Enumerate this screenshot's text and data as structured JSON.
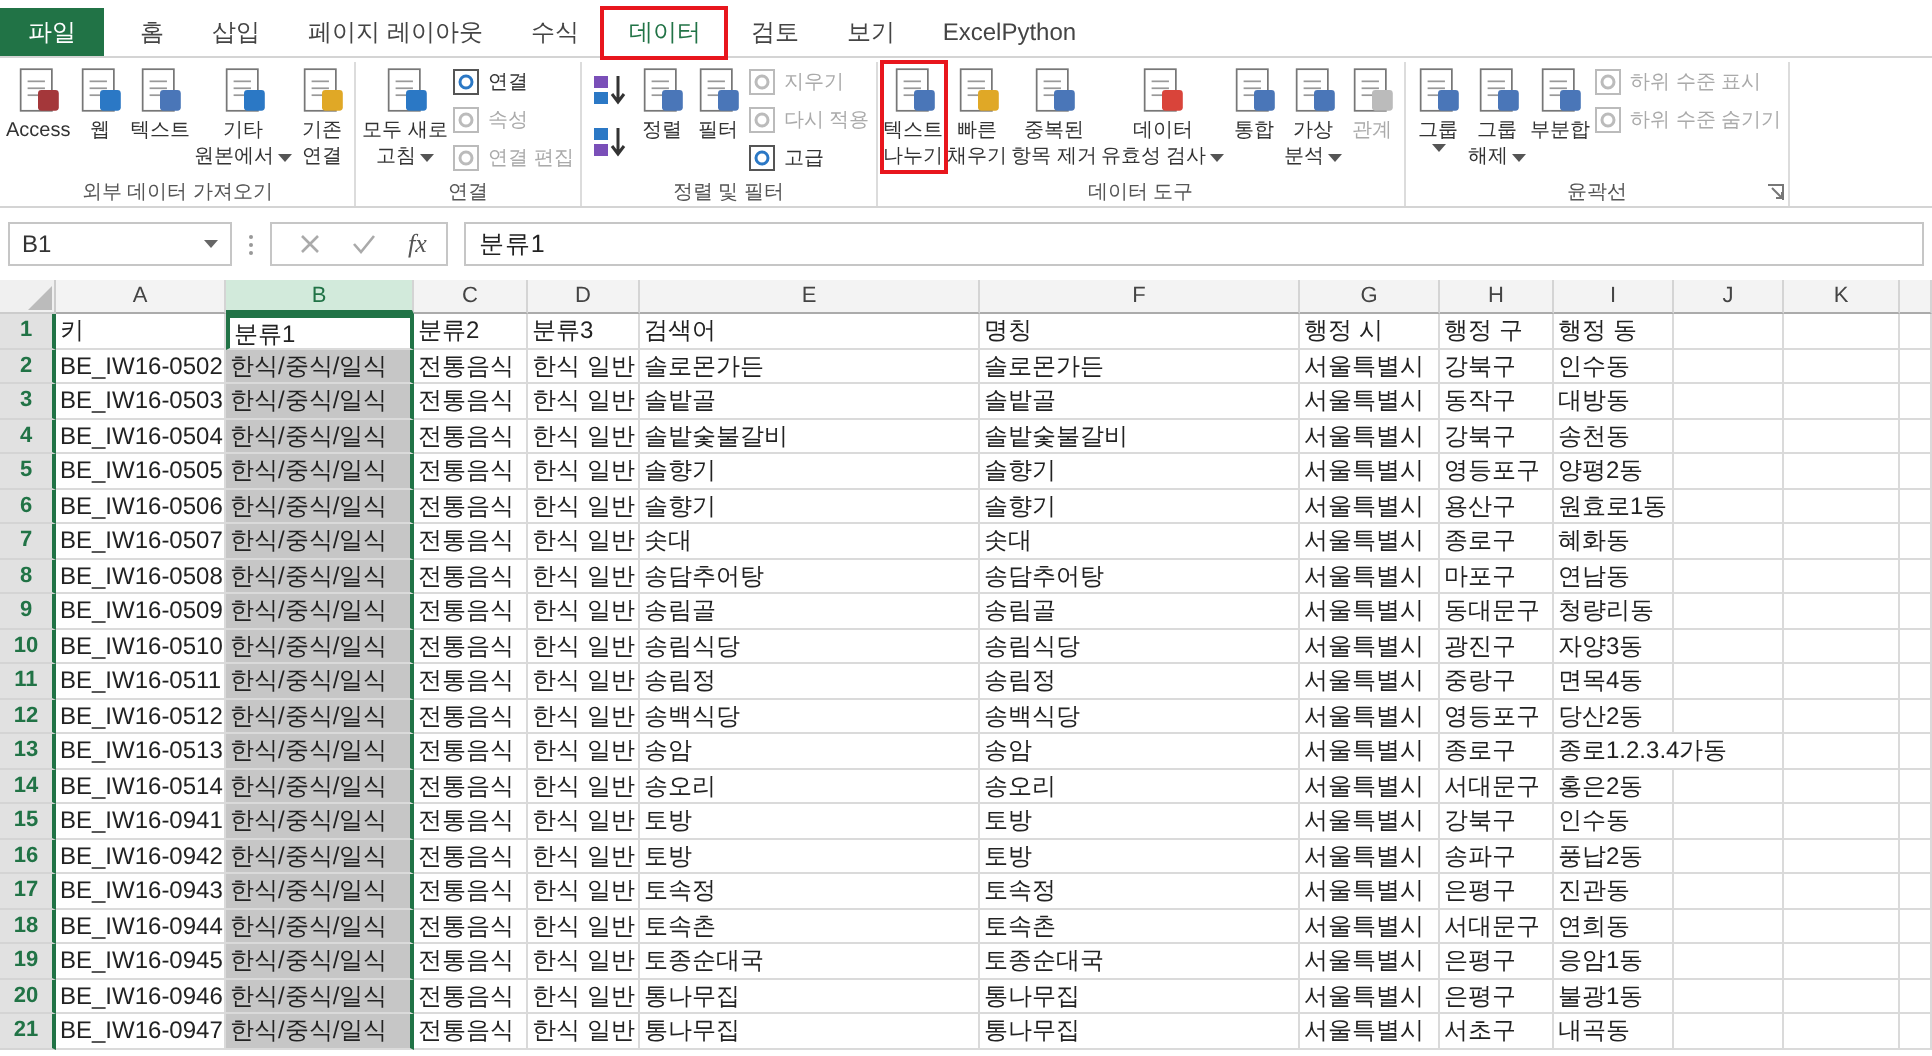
{
  "tabs": [
    {
      "label": "파일",
      "kind": "file",
      "selected": false,
      "highlighted": false
    },
    {
      "label": "홈",
      "kind": "tab",
      "selected": false,
      "highlighted": false
    },
    {
      "label": "삽입",
      "kind": "tab",
      "selected": false,
      "highlighted": false
    },
    {
      "label": "페이지 레이아웃",
      "kind": "tab",
      "selected": false,
      "highlighted": false
    },
    {
      "label": "수식",
      "kind": "tab",
      "selected": false,
      "highlighted": false
    },
    {
      "label": "데이터",
      "kind": "tab",
      "selected": true,
      "highlighted": true
    },
    {
      "label": "검토",
      "kind": "tab",
      "selected": false,
      "highlighted": false
    },
    {
      "label": "보기",
      "kind": "tab",
      "selected": false,
      "highlighted": false
    },
    {
      "label": "ExcelPython",
      "kind": "tab",
      "selected": false,
      "highlighted": false
    }
  ],
  "ribbon": {
    "groups": [
      {
        "label": "외부 데이터 가져오기",
        "items": [
          {
            "kind": "large",
            "lines": [
              "Access"
            ],
            "dropdown": false,
            "disabled": false,
            "highlighted": false
          },
          {
            "kind": "large",
            "lines": [
              "웹"
            ],
            "dropdown": false,
            "disabled": false,
            "highlighted": false
          },
          {
            "kind": "large",
            "lines": [
              "텍스트"
            ],
            "dropdown": false,
            "disabled": false,
            "highlighted": false
          },
          {
            "kind": "large",
            "lines": [
              "기타",
              "원본에서"
            ],
            "dropdown": true,
            "disabled": false,
            "highlighted": false
          },
          {
            "kind": "large",
            "lines": [
              "기존",
              "연결"
            ],
            "dropdown": false,
            "disabled": false,
            "highlighted": false
          }
        ]
      },
      {
        "label": "연결",
        "items": [
          {
            "kind": "large",
            "lines": [
              "모두 새로",
              "고침"
            ],
            "dropdown": true,
            "disabled": false,
            "highlighted": false
          },
          {
            "kind": "stack",
            "items": [
              {
                "label": "연결",
                "disabled": false
              },
              {
                "label": "속성",
                "disabled": true
              },
              {
                "label": "연결 편집",
                "disabled": true
              }
            ]
          }
        ]
      },
      {
        "label": "정렬 및 필터",
        "items": [
          {
            "kind": "sort-icons"
          },
          {
            "kind": "large",
            "lines": [
              "정렬"
            ],
            "dropdown": false,
            "disabled": false,
            "highlighted": false
          },
          {
            "kind": "large",
            "lines": [
              "필터"
            ],
            "dropdown": false,
            "disabled": false,
            "highlighted": false
          },
          {
            "kind": "stack",
            "items": [
              {
                "label": "지우기",
                "disabled": true
              },
              {
                "label": "다시 적용",
                "disabled": true
              },
              {
                "label": "고급",
                "disabled": false
              }
            ]
          }
        ]
      },
      {
        "label": "데이터 도구",
        "items": [
          {
            "kind": "large",
            "lines": [
              "텍스트",
              "나누기"
            ],
            "dropdown": false,
            "disabled": false,
            "highlighted": true
          },
          {
            "kind": "large",
            "lines": [
              "빠른",
              "채우기"
            ],
            "dropdown": false,
            "disabled": false,
            "highlighted": false
          },
          {
            "kind": "large",
            "lines": [
              "중복된",
              "항목 제거"
            ],
            "dropdown": false,
            "disabled": false,
            "highlighted": false
          },
          {
            "kind": "large",
            "lines": [
              "데이터",
              "유효성 검사"
            ],
            "dropdown": true,
            "disabled": false,
            "highlighted": false
          },
          {
            "kind": "large",
            "lines": [
              "통합"
            ],
            "dropdown": false,
            "disabled": false,
            "highlighted": false
          },
          {
            "kind": "large",
            "lines": [
              "가상",
              "분석"
            ],
            "dropdown": true,
            "disabled": false,
            "highlighted": false
          },
          {
            "kind": "large",
            "lines": [
              "관계"
            ],
            "dropdown": false,
            "disabled": true,
            "highlighted": false
          }
        ]
      },
      {
        "label": "윤곽선",
        "items": [
          {
            "kind": "large",
            "lines": [
              "그룹"
            ],
            "dropdown": true,
            "disabled": false,
            "highlighted": false
          },
          {
            "kind": "large",
            "lines": [
              "그룹",
              "해제"
            ],
            "dropdown": true,
            "disabled": false,
            "highlighted": false
          },
          {
            "kind": "large",
            "lines": [
              "부분합"
            ],
            "dropdown": false,
            "disabled": false,
            "highlighted": false
          },
          {
            "kind": "stack",
            "items": [
              {
                "label": "하위 수준 표시",
                "disabled": true
              },
              {
                "label": "하위 수준 숨기기",
                "disabled": true
              }
            ]
          }
        ]
      }
    ]
  },
  "formula_bar": {
    "name_box": "B1",
    "function_label": "fx",
    "value": "분류1"
  },
  "table": {
    "columns": [
      {
        "letter": "A",
        "selected": false
      },
      {
        "letter": "B",
        "selected": true
      },
      {
        "letter": "C",
        "selected": false
      },
      {
        "letter": "D",
        "selected": false
      },
      {
        "letter": "E",
        "selected": false
      },
      {
        "letter": "F",
        "selected": false
      },
      {
        "letter": "G",
        "selected": false
      },
      {
        "letter": "H",
        "selected": false
      },
      {
        "letter": "I",
        "selected": false
      },
      {
        "letter": "J",
        "selected": false
      },
      {
        "letter": "K",
        "selected": false
      }
    ],
    "rows": [
      {
        "number": "1",
        "active": true,
        "cells": [
          "키",
          "분류1",
          "분류2",
          "분류3",
          "검색어",
          "명칭",
          "행정 시",
          "행정 구",
          "행정 동"
        ]
      },
      {
        "number": "2",
        "active": false,
        "cells": [
          "BE_IW16-0502",
          "한식/중식/일식",
          "전통음식",
          "한식 일반",
          "솔로몬가든",
          "솔로몬가든",
          "서울특별시",
          "강북구",
          "인수동"
        ]
      },
      {
        "number": "3",
        "active": false,
        "cells": [
          "BE_IW16-0503",
          "한식/중식/일식",
          "전통음식",
          "한식 일반",
          "솔밭골",
          "솔밭골",
          "서울특별시",
          "동작구",
          "대방동"
        ]
      },
      {
        "number": "4",
        "active": false,
        "cells": [
          "BE_IW16-0504",
          "한식/중식/일식",
          "전통음식",
          "한식 일반",
          "솔밭숯불갈비",
          "솔밭숯불갈비",
          "서울특별시",
          "강북구",
          "송천동"
        ]
      },
      {
        "number": "5",
        "active": false,
        "cells": [
          "BE_IW16-0505",
          "한식/중식/일식",
          "전통음식",
          "한식 일반",
          "솔향기",
          "솔향기",
          "서울특별시",
          "영등포구",
          "양평2동"
        ]
      },
      {
        "number": "6",
        "active": false,
        "cells": [
          "BE_IW16-0506",
          "한식/중식/일식",
          "전통음식",
          "한식 일반",
          "솔향기",
          "솔향기",
          "서울특별시",
          "용산구",
          "원효로1동"
        ]
      },
      {
        "number": "7",
        "active": false,
        "cells": [
          "BE_IW16-0507",
          "한식/중식/일식",
          "전통음식",
          "한식 일반",
          "솟대",
          "솟대",
          "서울특별시",
          "종로구",
          "혜화동"
        ]
      },
      {
        "number": "8",
        "active": false,
        "cells": [
          "BE_IW16-0508",
          "한식/중식/일식",
          "전통음식",
          "한식 일반",
          "송담추어탕",
          "송담추어탕",
          "서울특별시",
          "마포구",
          "연남동"
        ]
      },
      {
        "number": "9",
        "active": false,
        "cells": [
          "BE_IW16-0509",
          "한식/중식/일식",
          "전통음식",
          "한식 일반",
          "송림골",
          "송림골",
          "서울특별시",
          "동대문구",
          "청량리동"
        ]
      },
      {
        "number": "10",
        "active": false,
        "cells": [
          "BE_IW16-0510",
          "한식/중식/일식",
          "전통음식",
          "한식 일반",
          "송림식당",
          "송림식당",
          "서울특별시",
          "광진구",
          "자양3동"
        ]
      },
      {
        "number": "11",
        "active": false,
        "cells": [
          "BE_IW16-0511",
          "한식/중식/일식",
          "전통음식",
          "한식 일반",
          "송림정",
          "송림정",
          "서울특별시",
          "중랑구",
          "면목4동"
        ]
      },
      {
        "number": "12",
        "active": false,
        "cells": [
          "BE_IW16-0512",
          "한식/중식/일식",
          "전통음식",
          "한식 일반",
          "송백식당",
          "송백식당",
          "서울특별시",
          "영등포구",
          "당산2동"
        ]
      },
      {
        "number": "13",
        "active": false,
        "cells": [
          "BE_IW16-0513",
          "한식/중식/일식",
          "전통음식",
          "한식 일반",
          "송암",
          "송암",
          "서울특별시",
          "종로구",
          "종로1.2.3.4가동"
        ]
      },
      {
        "number": "14",
        "active": false,
        "cells": [
          "BE_IW16-0514",
          "한식/중식/일식",
          "전통음식",
          "한식 일반",
          "송오리",
          "송오리",
          "서울특별시",
          "서대문구",
          "홍은2동"
        ]
      },
      {
        "number": "15",
        "active": false,
        "cells": [
          "BE_IW16-0941",
          "한식/중식/일식",
          "전통음식",
          "한식 일반",
          "토방",
          "토방",
          "서울특별시",
          "강북구",
          "인수동"
        ]
      },
      {
        "number": "16",
        "active": false,
        "cells": [
          "BE_IW16-0942",
          "한식/중식/일식",
          "전통음식",
          "한식 일반",
          "토방",
          "토방",
          "서울특별시",
          "송파구",
          "풍납2동"
        ]
      },
      {
        "number": "17",
        "active": false,
        "cells": [
          "BE_IW16-0943",
          "한식/중식/일식",
          "전통음식",
          "한식 일반",
          "토속정",
          "토속정",
          "서울특별시",
          "은평구",
          "진관동"
        ]
      },
      {
        "number": "18",
        "active": false,
        "cells": [
          "BE_IW16-0944",
          "한식/중식/일식",
          "전통음식",
          "한식 일반",
          "토속촌",
          "토속촌",
          "서울특별시",
          "서대문구",
          "연희동"
        ]
      },
      {
        "number": "19",
        "active": false,
        "cells": [
          "BE_IW16-0945",
          "한식/중식/일식",
          "전통음식",
          "한식 일반",
          "토종순대국",
          "토종순대국",
          "서울특별시",
          "은평구",
          "응암1동"
        ]
      },
      {
        "number": "20",
        "active": false,
        "cells": [
          "BE_IW16-0946",
          "한식/중식/일식",
          "전통음식",
          "한식 일반",
          "통나무집",
          "통나무집",
          "서울특별시",
          "은평구",
          "불광1동"
        ]
      },
      {
        "number": "21",
        "active": false,
        "cells": [
          "BE_IW16-0947",
          "한식/중식/일식",
          "전통음식",
          "한식 일반",
          "통나무집",
          "통나무집",
          "서울특별시",
          "서초구",
          "내곡동"
        ]
      }
    ]
  }
}
